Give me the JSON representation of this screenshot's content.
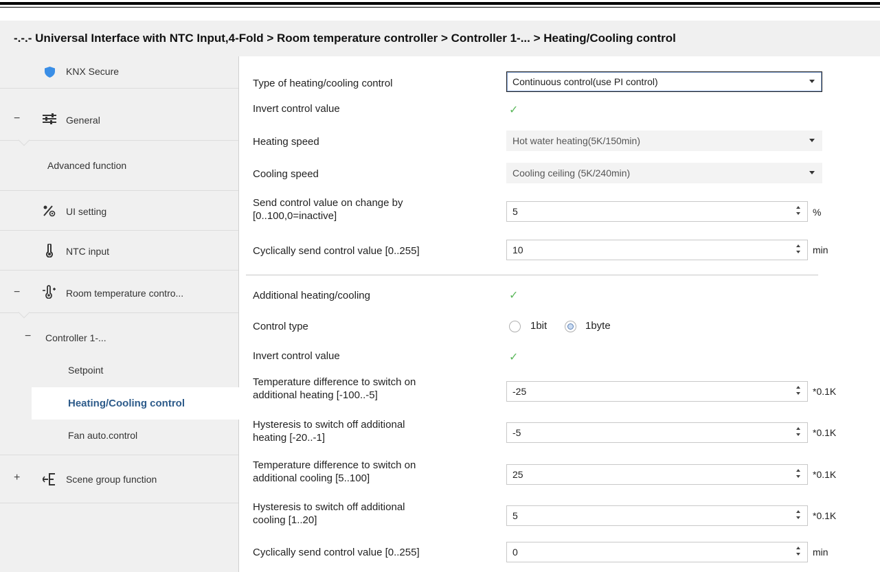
{
  "breadcrumb": "-.-.- Universal Interface with NTC Input,4-Fold > Room temperature controller > Controller 1-... > Heating/Cooling control",
  "colors": {
    "accent_selected": "#2d5b8a",
    "check_green": "#5cb85c",
    "shield_blue": "#3a8ee6"
  },
  "sidebar": {
    "items": [
      {
        "label": "KNX Secure",
        "icon": "shield-icon"
      },
      {
        "label": "General",
        "icon": "sliders-icon",
        "toggle": "−"
      },
      {
        "label": "Advanced function"
      },
      {
        "label": "UI setting",
        "icon": "ui-setting-icon"
      },
      {
        "label": "NTC input",
        "icon": "thermometer-icon"
      },
      {
        "label": "Room temperature contro...",
        "icon": "thermostat-icon",
        "toggle": "−"
      },
      {
        "label": "Controller 1-...",
        "toggle": "−"
      },
      {
        "label": "Setpoint"
      },
      {
        "label": "Heating/Cooling control",
        "selected": true
      },
      {
        "label": "Fan auto.control"
      },
      {
        "label": "Scene group function",
        "icon": "scene-icon",
        "toggle": "+"
      }
    ]
  },
  "params": {
    "type_hc": {
      "label": "Type of heating/cooling control",
      "value": "Continuous control(use PI control)"
    },
    "invert1": {
      "label": "Invert control value",
      "checked": true
    },
    "heating_speed": {
      "label": "Heating speed",
      "value": "Hot water heating(5K/150min)"
    },
    "cooling_speed": {
      "label": "Cooling speed",
      "value": "Cooling ceiling (5K/240min)"
    },
    "send_change": {
      "label_1": "Send control value on change by",
      "label_2": "[0..100,0=inactive]",
      "value": "5",
      "unit": "%"
    },
    "cyclic1": {
      "label": "Cyclically send control value [0..255]",
      "value": "10",
      "unit": "min"
    },
    "additional": {
      "label": "Additional heating/cooling",
      "checked": true
    },
    "control_type": {
      "label": "Control type",
      "option_1": "1bit",
      "option_2": "1byte",
      "selected": "1byte"
    },
    "invert2": {
      "label": "Invert control value",
      "checked": true
    },
    "temp_diff_heat": {
      "label_1": "Temperature difference to switch on",
      "label_2": "additional heating [-100..-5]",
      "value": "-25",
      "unit": "*0.1K"
    },
    "hyst_heat": {
      "label_1": "Hysteresis to switch off additional",
      "label_2": "heating [-20..-1]",
      "value": "-5",
      "unit": "*0.1K"
    },
    "temp_diff_cool": {
      "label_1": "Temperature difference to switch on",
      "label_2": "additional cooling [5..100]",
      "value": "25",
      "unit": "*0.1K"
    },
    "hyst_cool": {
      "label_1": "Hysteresis to switch off additional",
      "label_2": "cooling [1..20]",
      "value": "5",
      "unit": "*0.1K"
    },
    "cyclic2": {
      "label": "Cyclically send control value [0..255]",
      "value": "0",
      "unit": "min"
    }
  }
}
